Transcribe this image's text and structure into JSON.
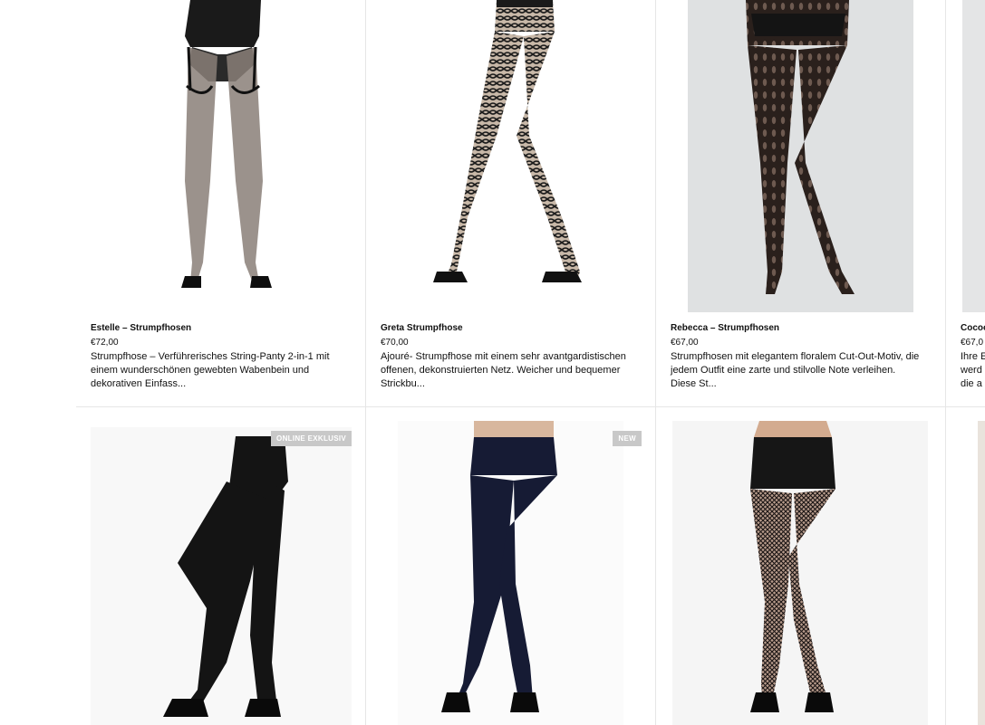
{
  "products_row1": [
    {
      "name": "Estelle – Strumpfhosen",
      "price": "€72,00",
      "desc": "Strumpfhose – Verführerisches String-Panty 2-in-1 mit einem wunderschönen gewebten Wabenbein und dekorativen Einfass..."
    },
    {
      "name": "Greta Strumpfhose",
      "price": "€70,00",
      "desc": "Ajouré- Strumpfhose mit einem sehr avantgardistischen offenen, dekonstruierten Netz. Weicher und bequemer Strickbu..."
    },
    {
      "name": "Rebecca – Strumpfhosen",
      "price": "€67,00",
      "desc": "Strumpfhosen mit elegantem floralem Cut-Out-Motiv, die jedem Outfit eine zarte und stilvolle Note verleihen. Diese St..."
    },
    {
      "name": "Cocoo",
      "price": "€67,0",
      "desc": "Ihre E werd die a"
    }
  ],
  "badges": {
    "online_exclusive": "ONLINE EXKLUSIV",
    "new": "NEW"
  },
  "colors": {
    "divider": "#e6e6e6",
    "badge": "#c8c8c8",
    "legs_black": "#141414",
    "legs_navy": "#161b34"
  }
}
